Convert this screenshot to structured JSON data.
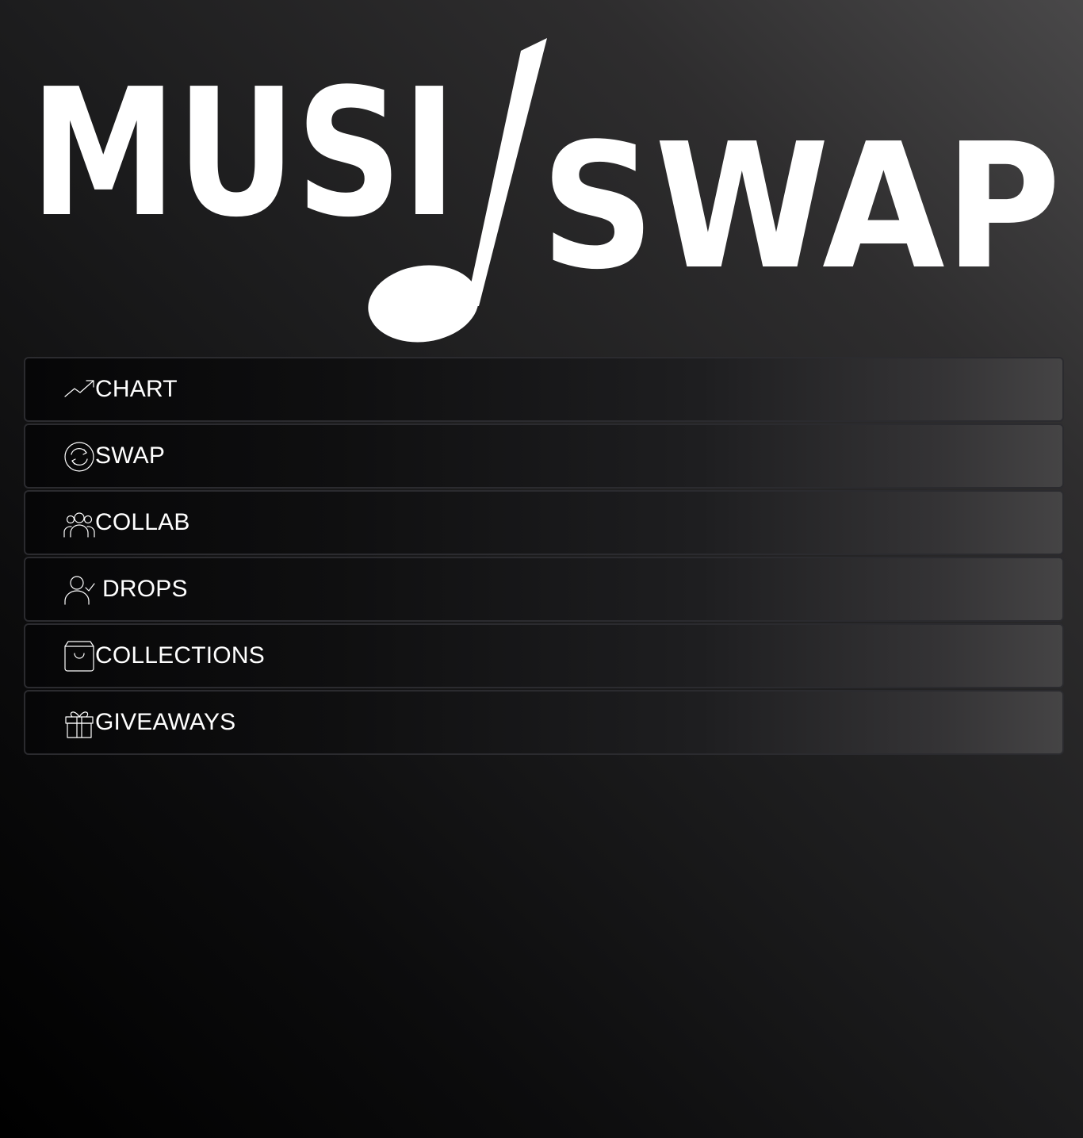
{
  "logo": {
    "left_text": "MUSI",
    "right_text": "SWAP",
    "icon": "music-note-icon"
  },
  "menu": {
    "items": [
      {
        "label": "CHART",
        "icon": "trending-up-icon"
      },
      {
        "label": "SWAP",
        "icon": "swap-cycle-icon"
      },
      {
        "label": "COLLAB",
        "icon": "users-group-icon"
      },
      {
        "label": "DROPS",
        "icon": "user-check-icon"
      },
      {
        "label": "COLLECTIONS",
        "icon": "shopping-bag-icon"
      },
      {
        "label": "GIVEAWAYS",
        "icon": "gift-icon"
      }
    ]
  },
  "colors": {
    "text": "#ffffff",
    "background_dark": "#000000",
    "background_light": "#494849",
    "item_border": "#2b2b2f"
  }
}
